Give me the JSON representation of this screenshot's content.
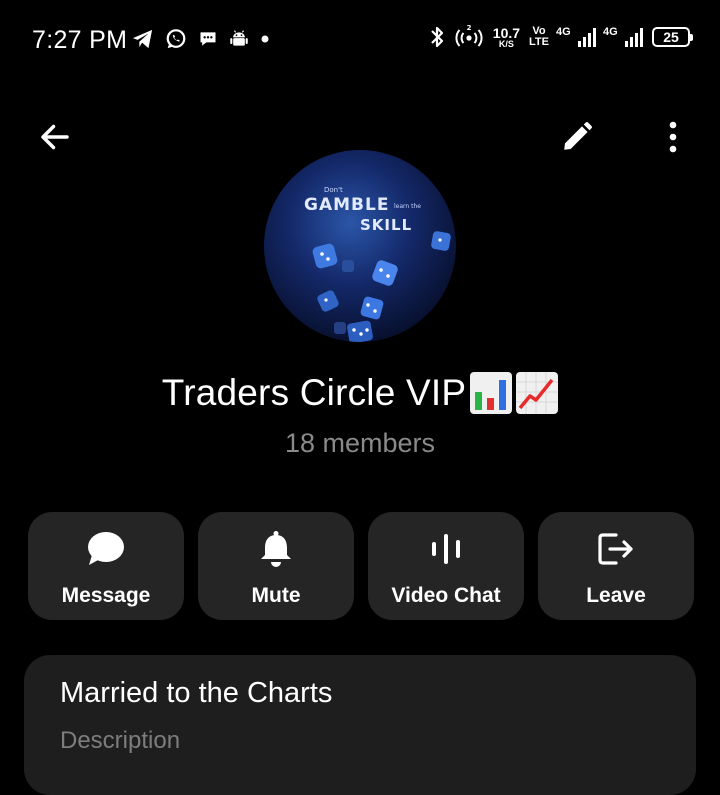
{
  "status_bar": {
    "time": "7:27 PM",
    "left_icons": [
      "telegram-icon",
      "whatsapp-icon",
      "chat-bubble-icon",
      "android-icon",
      "dot-icon"
    ],
    "net_speed_value": "10.7",
    "net_speed_unit": "K/S",
    "volte_top": "Vo",
    "volte_bottom": "LTE",
    "sim1_label": "4G",
    "sim2_label": "4G",
    "battery_level": "25"
  },
  "header": {
    "back_icon": "arrow-left-icon",
    "edit_icon": "pencil-icon",
    "more_icon": "more-vertical-icon"
  },
  "avatar": {
    "line1": "Don't",
    "line2": "GAMBLE",
    "line3": "learn the",
    "line4": "SKILL"
  },
  "group": {
    "name": "Traders Circle VIP",
    "emojis": [
      "bar-chart-emoji",
      "chart-increasing-emoji"
    ],
    "members": "18 members"
  },
  "actions": [
    {
      "label": "Message",
      "icon": "chat-bubble-icon"
    },
    {
      "label": "Mute",
      "icon": "bell-icon"
    },
    {
      "label": "Video Chat",
      "icon": "audio-bars-icon"
    },
    {
      "label": "Leave",
      "icon": "logout-icon"
    }
  ],
  "description": {
    "text": "Married to the Charts",
    "label": "Description"
  },
  "colors": {
    "background": "#000000",
    "card": "#252525",
    "secondary_text": "#8a8a8a"
  }
}
